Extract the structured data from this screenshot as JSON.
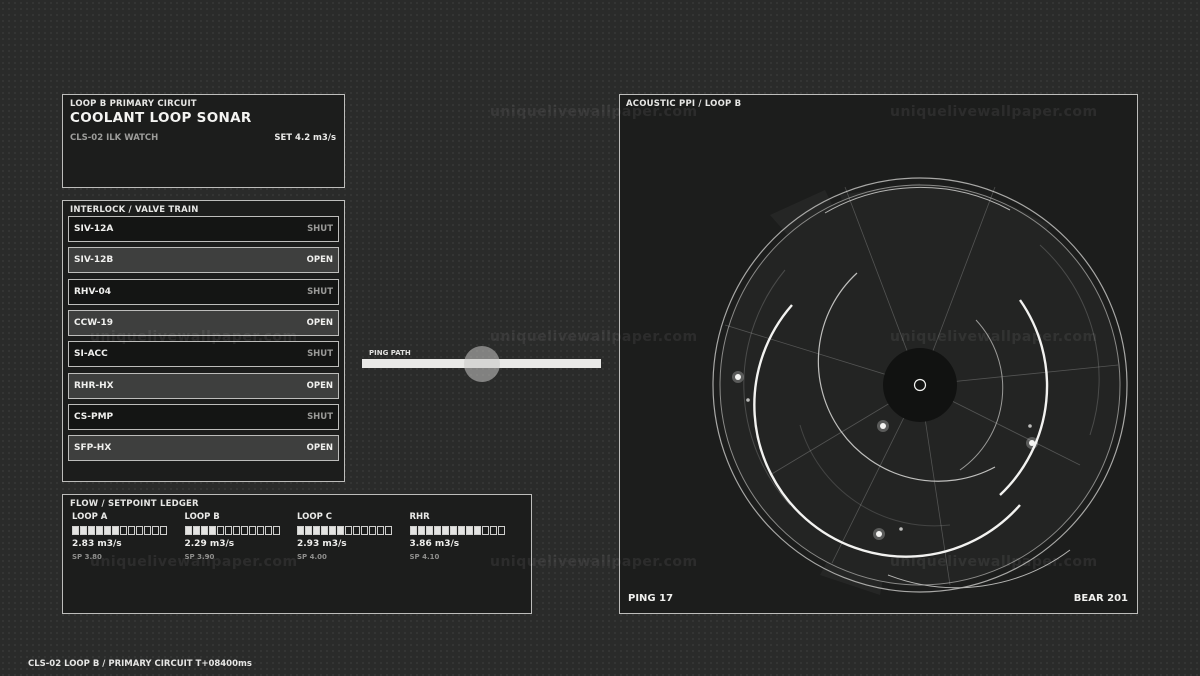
{
  "header": {
    "subtitle": "LOOP B  PRIMARY CIRCUIT",
    "title": "COOLANT LOOP SONAR",
    "code": "CLS-02   ILK WATCH",
    "setpoint": "SET  4.2 m3/s"
  },
  "interlock": {
    "title": "INTERLOCK / VALVE TRAIN",
    "valves": [
      {
        "name": "SIV-12A",
        "state": "SHUT"
      },
      {
        "name": "SIV-12B",
        "state": "OPEN"
      },
      {
        "name": "RHV-04",
        "state": "SHUT"
      },
      {
        "name": "CCW-19",
        "state": "OPEN"
      },
      {
        "name": "SI-ACC",
        "state": "SHUT"
      },
      {
        "name": "RHR-HX",
        "state": "OPEN"
      },
      {
        "name": "CS-PMP",
        "state": "SHUT"
      },
      {
        "name": "SFP-HX",
        "state": "OPEN"
      }
    ]
  },
  "flow": {
    "title": "FLOW / SETPOINT LEDGER",
    "loops": [
      {
        "name": "LOOP A",
        "value": "2.83 m3/s",
        "setpoint": "SP 3.80",
        "filled": 6,
        "segments": 12
      },
      {
        "name": "LOOP B",
        "value": "2.29 m3/s",
        "setpoint": "SP 3.90",
        "filled": 4,
        "segments": 12
      },
      {
        "name": "LOOP C",
        "value": "2.93 m3/s",
        "setpoint": "SP 4.00",
        "filled": 6,
        "segments": 12
      },
      {
        "name": "RHR",
        "value": "3.86 m3/s",
        "setpoint": "SP 4.10",
        "filled": 9,
        "segments": 12
      }
    ]
  },
  "ping_path": {
    "label": "PING PATH",
    "position": 0.5
  },
  "sonar": {
    "title": "ACOUSTIC PPI  /  LOOP B",
    "ping": "PING 17",
    "bearing": "BEAR 201"
  },
  "watermark": "uniquelivewallpaper.com",
  "footer": "CLS-02  LOOP B / PRIMARY CIRCUIT  T+08400ms",
  "colors": {
    "background": "#2a2b2a",
    "panel": "#1c1d1c",
    "border": "#bdbdbb",
    "accent": "#f4f4f2"
  }
}
